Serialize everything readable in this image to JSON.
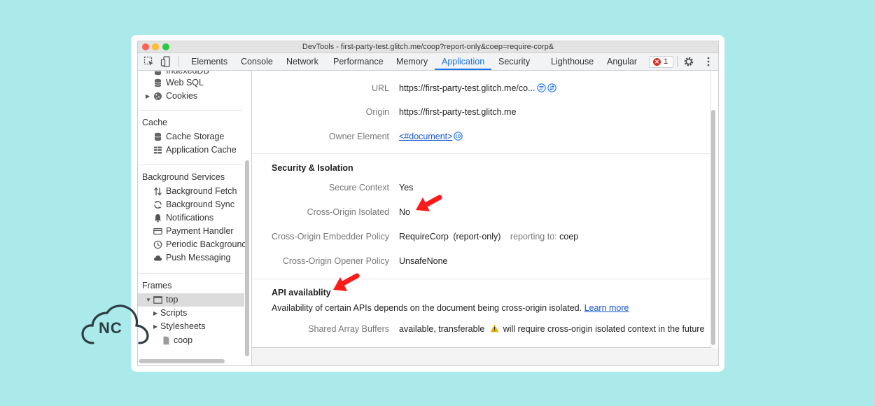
{
  "window": {
    "title": "DevTools - first-party-test.glitch.me/coop?report-only&coep=require-corp&"
  },
  "tabs": [
    {
      "label": "Elements"
    },
    {
      "label": "Console"
    },
    {
      "label": "Network"
    },
    {
      "label": "Performance"
    },
    {
      "label": "Memory"
    },
    {
      "label": "Application",
      "active": true
    },
    {
      "label": "Security"
    },
    {
      "label": "Lighthouse"
    },
    {
      "label": "Angular"
    }
  ],
  "toolbar": {
    "error_count": "1",
    "icons": [
      "inspect-icon",
      "device-toggle-icon",
      "error-icon",
      "gear-icon",
      "more-vertical-icon"
    ]
  },
  "sidebar": {
    "storage_items": [
      {
        "label": "IndexedDB",
        "icon": "database-icon"
      },
      {
        "label": "Web SQL",
        "icon": "database-icon"
      },
      {
        "label": "Cookies",
        "icon": "cookie-icon"
      }
    ],
    "cache": {
      "heading": "Cache",
      "items": [
        {
          "label": "Cache Storage",
          "icon": "database-icon"
        },
        {
          "label": "Application Cache",
          "icon": "grid-icon"
        }
      ]
    },
    "background": {
      "heading": "Background Services",
      "items": [
        {
          "label": "Background Fetch",
          "icon": "up-down-arrows-icon"
        },
        {
          "label": "Background Sync",
          "icon": "sync-icon"
        },
        {
          "label": "Notifications",
          "icon": "bell-icon"
        },
        {
          "label": "Payment Handler",
          "icon": "card-icon"
        },
        {
          "label": "Periodic Background",
          "icon": "clock-icon"
        },
        {
          "label": "Push Messaging",
          "icon": "cloud-icon"
        }
      ]
    },
    "frames": {
      "heading": "Frames",
      "top": "top",
      "children": [
        "Scripts",
        "Stylesheets"
      ],
      "file": "coop"
    }
  },
  "document": {
    "rows": [
      {
        "label": "URL",
        "value": "https://first-party-test.glitch.me/co..."
      },
      {
        "label": "Origin",
        "value": "https://first-party-test.glitch.me"
      },
      {
        "label": "Owner Element",
        "value": "<#document>"
      }
    ]
  },
  "security": {
    "title": "Security & Isolation",
    "rows": [
      {
        "label": "Secure Context",
        "value": "Yes"
      },
      {
        "label": "Cross-Origin Isolated",
        "value": "No"
      },
      {
        "label": "Cross-Origin Embedder Policy",
        "value": "RequireCorp",
        "mode": "(report-only)",
        "reporting_label": "reporting to:",
        "reporting_value": "coep"
      },
      {
        "label": "Cross-Origin Opener Policy",
        "value": "UnsafeNone"
      }
    ]
  },
  "api": {
    "title": "API availablity",
    "description": "Availability of certain APIs depends on the document being cross-origin isolated.",
    "learn_more": "Learn more",
    "row_label": "Shared Array Buffers",
    "row_value": "available, transferable",
    "warning": "will require cross-origin isolated context in the future"
  },
  "colors": {
    "background": "#aaeaea",
    "accent": "#1a73e8",
    "annotation_arrow": "#ff1a1a",
    "link": "#1155cc"
  },
  "logo": {
    "text": "NC"
  }
}
